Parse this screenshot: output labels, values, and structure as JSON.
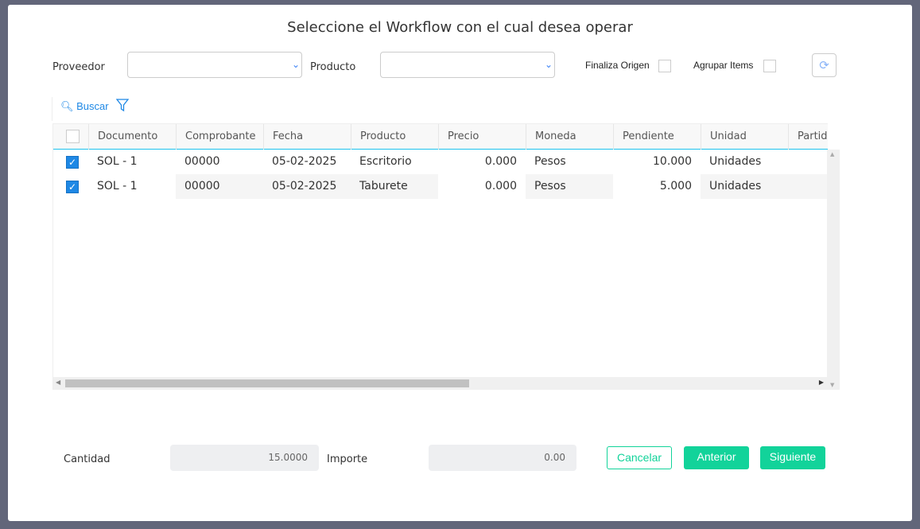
{
  "title": "Seleccione el Workflow con el cual desea operar",
  "filters": {
    "proveedor_label": "Proveedor",
    "proveedor_value": "",
    "producto_label": "Producto",
    "producto_value": "",
    "finaliza_origen_label": "Finaliza Origen",
    "finaliza_origen_checked": false,
    "agrupar_items_label": "Agrupar Items",
    "agrupar_items_checked": false
  },
  "toolbar": {
    "search_label": "Buscar"
  },
  "table": {
    "columns": [
      "Documento",
      "Comprobante",
      "Fecha",
      "Producto",
      "Precio",
      "Moneda",
      "Pendiente",
      "Unidad",
      "Partid"
    ],
    "rows": [
      {
        "checked": true,
        "cells": [
          "SOL - 1",
          "00000",
          "05-02-2025",
          "Escritorio",
          "0.000",
          "Pesos",
          "10.000",
          "Unidades",
          ""
        ]
      },
      {
        "checked": true,
        "cells": [
          "SOL - 1",
          "00000",
          "05-02-2025",
          "Taburete",
          "0.000",
          "Pesos",
          "5.000",
          "Unidades",
          ""
        ]
      }
    ]
  },
  "footer": {
    "cantidad_label": "Cantidad",
    "cantidad_value": "15.0000",
    "importe_label": "Importe",
    "importe_value": "0.00",
    "cancel": "Cancelar",
    "prev": "Anterior",
    "next": "Siguiente"
  },
  "colors": {
    "accent": "#12d39a",
    "link": "#1e88e5",
    "header_line": "#1ec3ee"
  }
}
